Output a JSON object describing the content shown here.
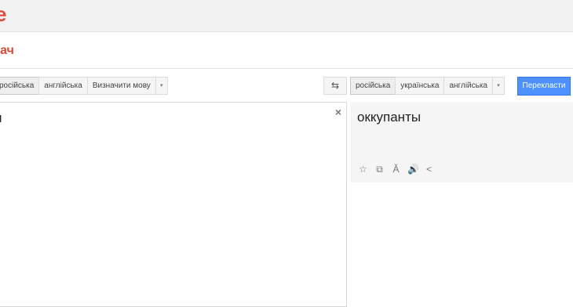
{
  "header": {
    "logo_text": "e"
  },
  "app": {
    "subtitle": "дач"
  },
  "source": {
    "languages": [
      "російська",
      "англійська",
      "Визначити мову"
    ],
    "dropdown": "▾",
    "text": "и",
    "clear": "×"
  },
  "swap_icon": "⇆",
  "target": {
    "languages": [
      "російська",
      "українська",
      "англійська"
    ],
    "dropdown": "▾",
    "text": "оккупанты",
    "tools": [
      "☆",
      "⧉",
      "Ă",
      "🔊",
      "<"
    ]
  },
  "translate_button": "Перекласти",
  "colors": {
    "brand": "#dd4b39",
    "accent": "#4d90fe"
  }
}
